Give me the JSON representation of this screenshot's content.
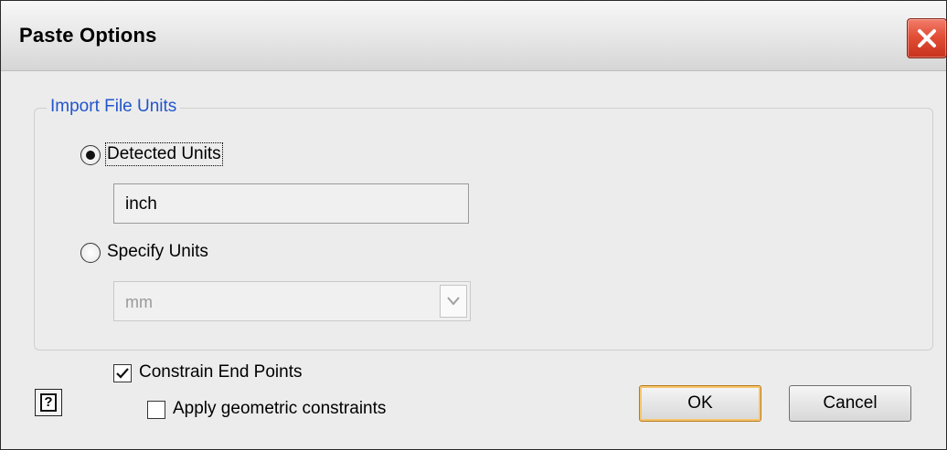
{
  "window": {
    "title": "Paste Options",
    "close_icon": "close-icon"
  },
  "import_units": {
    "group_label": "Import File Units",
    "detected": {
      "label": "Detected Units",
      "selected": true,
      "value": "inch"
    },
    "specify": {
      "label": "Specify Units",
      "selected": false,
      "selected_unit": "mm",
      "enabled": false
    }
  },
  "options": {
    "constrain_end_points": {
      "label": "Constrain End Points",
      "checked": true
    },
    "apply_geometric_constraints": {
      "label": "Apply geometric constraints",
      "checked": false
    }
  },
  "buttons": {
    "help_icon": "help-icon",
    "ok_label": "OK",
    "cancel_label": "Cancel"
  },
  "colors": {
    "group_label": "#2255cc",
    "close_button": "#e24e36",
    "ok_focus": "#f5c56a"
  }
}
